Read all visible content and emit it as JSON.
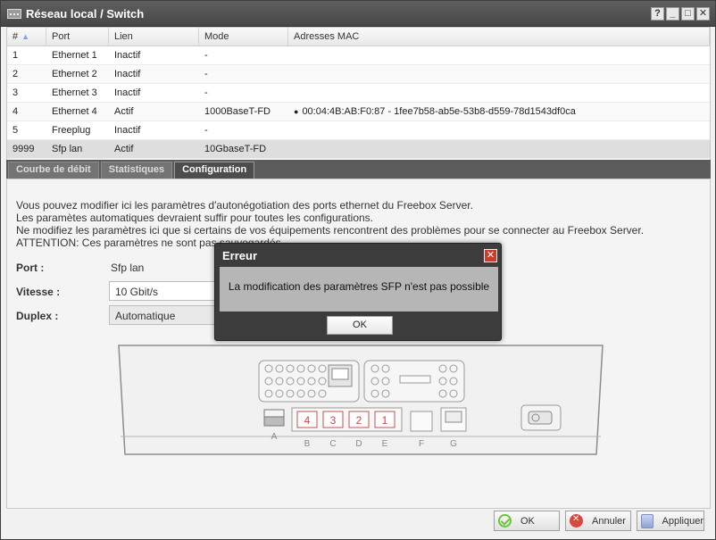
{
  "window": {
    "title": "Réseau local / Switch",
    "buttons": [
      "?",
      "_",
      "□",
      "✕"
    ]
  },
  "grid": {
    "headers": [
      "#",
      "Port",
      "Lien",
      "Mode",
      "Adresses MAC"
    ],
    "rows": [
      {
        "id": "1",
        "port": "Ethernet 1",
        "lien": "Inactif",
        "mode": "-",
        "mac": ""
      },
      {
        "id": "2",
        "port": "Ethernet 2",
        "lien": "Inactif",
        "mode": "-",
        "mac": ""
      },
      {
        "id": "3",
        "port": "Ethernet 3",
        "lien": "Inactif",
        "mode": "-",
        "mac": ""
      },
      {
        "id": "4",
        "port": "Ethernet 4",
        "lien": "Actif",
        "mode": "1000BaseT-FD",
        "mac": "00:04:4B:AB:F0:87 - 1fee7b58-ab5e-53b8-d559-78d1543df0ca"
      },
      {
        "id": "5",
        "port": "Freeplug",
        "lien": "Inactif",
        "mode": "-",
        "mac": ""
      },
      {
        "id": "9999",
        "port": "Sfp lan",
        "lien": "Actif",
        "mode": "10GbaseT-FD",
        "mac": ""
      }
    ]
  },
  "tabs": [
    "Courbe de débit",
    "Statistiques",
    "Configuration"
  ],
  "config": {
    "info_lines": [
      "Vous pouvez modifier ici les paramètres d'autonégotiation des ports ethernet du Freebox Server.",
      "Les paramètes automatiques devraient suffir pour toutes les configurations.",
      "Ne modifiez les paramètres ici que si certains de vos équipements rencontrent des problèmes pour se connecter au Freebox Server.",
      "ATTENTION: Ces paramètres ne sont pas sauvegardés."
    ],
    "port_label": "Port :",
    "port_value": "Sfp lan",
    "speed_label": "Vitesse :",
    "speed_value": "10 Gbit/s",
    "duplex_label": "Duplex :",
    "duplex_value": "Automatique"
  },
  "device": {
    "ports": [
      "4",
      "3",
      "2",
      "1"
    ],
    "letters": [
      "A",
      "B",
      "C",
      "D",
      "E",
      "F",
      "G"
    ]
  },
  "footer": {
    "ok": "OK",
    "cancel": "Annuler",
    "apply": "Appliquer"
  },
  "dialog": {
    "title": "Erreur",
    "message": "La modification des paramètres SFP n'est pas possible",
    "ok": "OK"
  }
}
